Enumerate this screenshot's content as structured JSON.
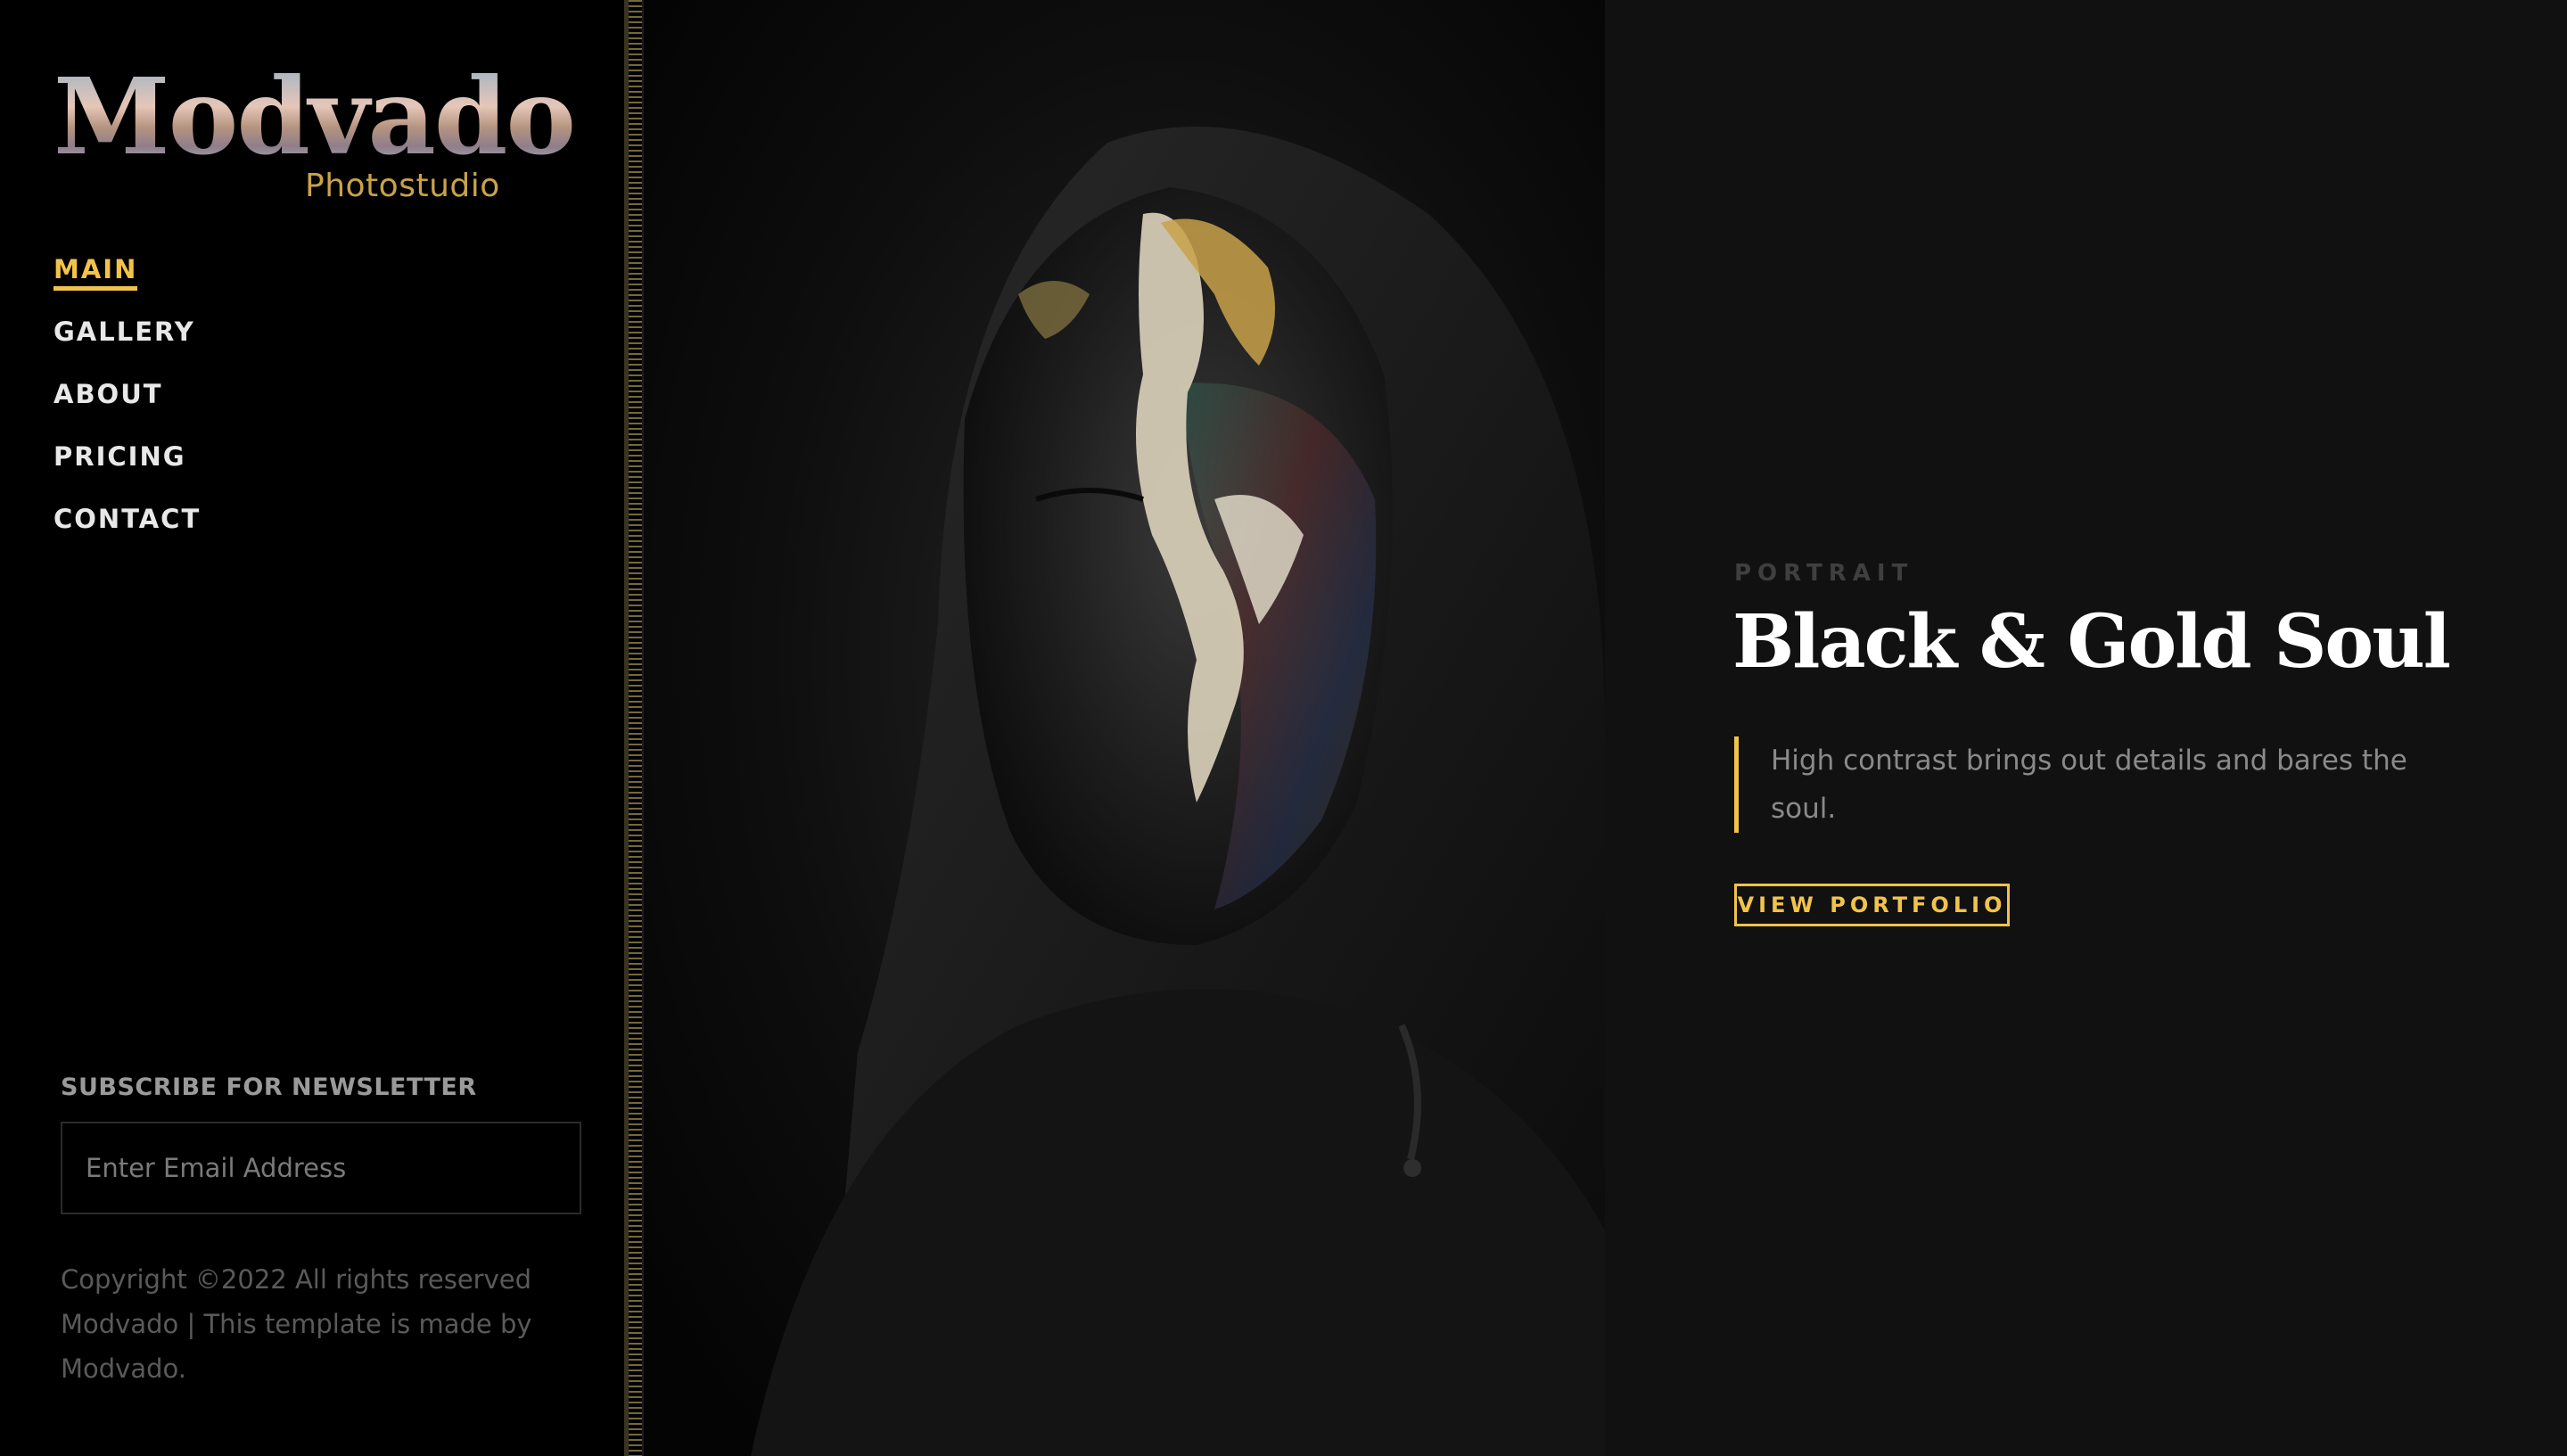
{
  "brand": {
    "name": "Modvado",
    "subtitle": "Photostudio"
  },
  "nav": {
    "items": [
      {
        "label": "MAIN",
        "active": true
      },
      {
        "label": "GALLERY",
        "active": false
      },
      {
        "label": "ABOUT",
        "active": false
      },
      {
        "label": "PRICING",
        "active": false
      },
      {
        "label": "CONTACT",
        "active": false
      }
    ]
  },
  "newsletter": {
    "label": "SUBSCRIBE FOR NEWSLETTER",
    "placeholder": "Enter Email Address",
    "value": ""
  },
  "footer": {
    "copyright": "Copyright ©2022 All rights reserved Modvado | This template is made by Modvado."
  },
  "hero": {
    "image_subject": "portrait-black-gold-face-paint"
  },
  "feature": {
    "category": "PORTRAIT",
    "title": "Black & Gold Soul",
    "description": "High contrast brings out details and bares the soul.",
    "cta_label": "VIEW PORTFOLIO"
  },
  "colors": {
    "accent": "#f2c34b",
    "background": "#000000",
    "panel": "#111111",
    "logo_sub": "#c9a24a"
  }
}
